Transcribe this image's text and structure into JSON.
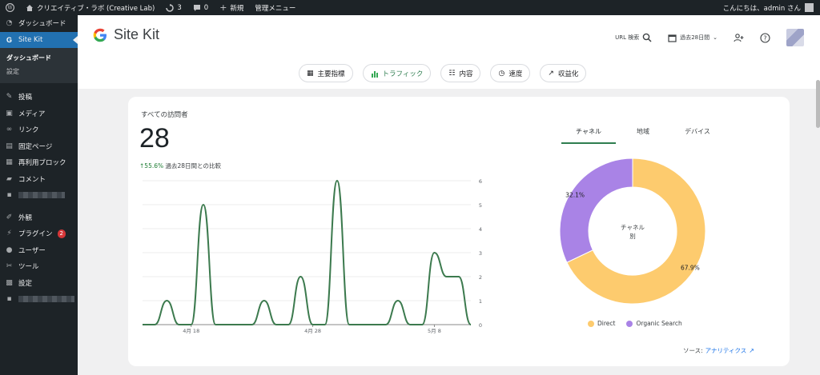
{
  "adminbar": {
    "site_name": "クリエイティブ・ラボ (Creative Lab)",
    "updates_count": "3",
    "comments_count": "0",
    "new_label": "新規",
    "manage_menu_label": "管理メニュー",
    "greeting": "こんにちは、admin さん"
  },
  "sidebar": {
    "dashboard": "ダッシュボード",
    "sitekit": "Site Kit",
    "sub_dashboard": "ダッシュボード",
    "sub_settings": "設定",
    "posts": "投稿",
    "media": "メディア",
    "links": "リンク",
    "pages": "固定ページ",
    "blocks": "再利用ブロック",
    "comments": "コメント",
    "appearance": "外観",
    "plugins": "プラグイン",
    "plugins_badge": "2",
    "users": "ユーザー",
    "tools": "ツール",
    "settings": "設定"
  },
  "header": {
    "logo_text": "Site Kit",
    "url_search_label": "URL 検索",
    "date_range_label": "過去28日間"
  },
  "nav": {
    "key_metrics": "主要指標",
    "traffic": "トラフィック",
    "content": "内容",
    "speed": "速度",
    "monetization": "収益化"
  },
  "card": {
    "title": "すべての訪問者",
    "total": "28",
    "change_value": "55.6%",
    "change_text": "過去28日間との比較",
    "tabs": [
      "チャネル",
      "地域",
      "デバイス"
    ],
    "donut_center_line1": "チャネル",
    "donut_center_line2": "別",
    "source_label": "ソース:",
    "source_link": "アナリティクス"
  },
  "colors": {
    "line": "#3c7a4e",
    "direct": "#fdcb6e",
    "organic": "#a983e6"
  },
  "chart_data": [
    {
      "type": "line",
      "x": [
        "4/14",
        "4/15",
        "4/16",
        "4/17",
        "4/18",
        "4/19",
        "4/20",
        "4/21",
        "4/22",
        "4/23",
        "4/24",
        "4/25",
        "4/26",
        "4/27",
        "4/28",
        "4/29",
        "4/30",
        "5/1",
        "5/2",
        "5/3",
        "5/4",
        "5/5",
        "5/6",
        "5/7",
        "5/8",
        "5/9",
        "5/10",
        "5/11"
      ],
      "series": [
        {
          "values": [
            0,
            0,
            1,
            0,
            0,
            5,
            0,
            0,
            0,
            0,
            1,
            0,
            0,
            2,
            0,
            0,
            6,
            0,
            0,
            0,
            0,
            1,
            0,
            0,
            3,
            2,
            2,
            0
          ]
        }
      ],
      "x_tick_labels": [
        "4月 18",
        "4月 28",
        "5月 8"
      ],
      "x_tick_dates": [
        "4/18",
        "4/28",
        "5/8"
      ],
      "y_ticks": [
        "0",
        "1",
        "2",
        "3",
        "4",
        "5",
        "6"
      ],
      "ylim": [
        0,
        6
      ],
      "grid": true
    },
    {
      "type": "pie",
      "labels": [
        "Direct",
        "Organic Search"
      ],
      "values": [
        67.9,
        32.1
      ],
      "value_labels": [
        "67.9%",
        "32.1%"
      ],
      "legend": "bottom"
    }
  ]
}
